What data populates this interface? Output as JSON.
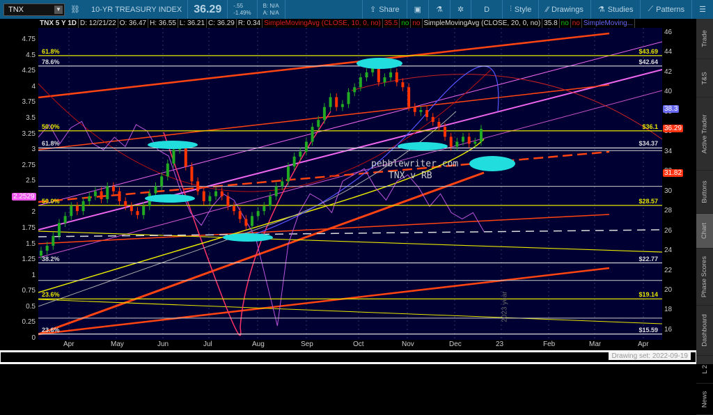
{
  "toolbar": {
    "symbol": "TNX",
    "description": "10-YR TREASURY INDEX",
    "last": "36.29",
    "change": "-.55",
    "change_pct": "-1.49%",
    "bid": "B: N/A",
    "ask": "A: N/A",
    "share": "Share",
    "period": "D",
    "style": "Style",
    "drawings": "Drawings",
    "studies": "Studies",
    "patterns": "Patterns"
  },
  "info": {
    "title": "TNX 5 Y 1D",
    "date": "D: 12/21/22",
    "open": "O: 36.47",
    "high": "H: 36.55",
    "low": "L: 36.21",
    "close": "C: 36.29",
    "range": "R: 0.34",
    "sma1": "SimpleMovingAvg (CLOSE, 10, 0, no)",
    "sma1_val": "35.5",
    "no": "no",
    "sma2": "SimpleMovingAvg (CLOSE, 20, 0, no)",
    "sma2_val": "35.8",
    "sma3": "SimpleMoving..."
  },
  "chart_data": {
    "type": "candlestick",
    "right_axis": {
      "ticks": [
        "46",
        "44",
        "42",
        "40",
        "38",
        "36",
        "34",
        "32",
        "30",
        "28",
        "26",
        "24",
        "22",
        "20",
        "18",
        "16"
      ],
      "range": [
        15,
        46.5
      ]
    },
    "left_axis": {
      "ticks": [
        "4.75",
        "4.5",
        "4.25",
        "4",
        "3.75",
        "3.5",
        "3.25",
        "3",
        "2.75",
        "2.5",
        "2",
        "1.75",
        "1.5",
        "1.25",
        "1",
        "0.75",
        "0.5",
        "0.25",
        "0"
      ],
      "range": [
        0,
        4.95
      ]
    },
    "x_ticks": [
      "Apr",
      "May",
      "Jun",
      "Jul",
      "Aug",
      "Sep",
      "Oct",
      "Nov",
      "Dec",
      "23",
      "Feb",
      "Mar",
      "Apr"
    ],
    "year_marker": "2023 year",
    "closes": [
      24,
      24.5,
      25.5,
      26.8,
      27.5,
      28.5,
      28,
      29,
      29.5,
      30,
      29.2,
      30.5,
      30,
      29,
      28.5,
      28,
      27.6,
      28.5,
      29.8,
      30.5,
      31.5,
      32.8,
      34.2,
      34.5,
      32.5,
      31,
      30,
      29,
      29.5,
      30,
      29.5,
      28.5,
      28,
      27.2,
      26.5,
      27.5,
      28,
      28.5,
      29.5,
      30.5,
      31,
      32.5,
      33.5,
      34,
      35,
      36.5,
      37.2,
      38.5,
      39.5,
      38.5,
      38.8,
      40,
      40.5,
      41.5,
      42,
      42.5,
      41,
      41.5,
      42,
      41,
      40.5,
      38.5,
      38,
      38.2,
      37.5,
      37,
      36.5,
      35.5,
      34.5,
      35,
      35.5,
      34.8,
      35,
      36.29
    ],
    "price_levels": [
      {
        "v": 43.69,
        "label": "$43.69",
        "fib": "61.8%",
        "c": "#e8e800"
      },
      {
        "v": 42.64,
        "label": "$42.64",
        "fib": "78.6%",
        "c": "#ddd"
      },
      {
        "v": 36.1,
        "label": "$36.1",
        "fib": "50.0%",
        "c": "#e8e800"
      },
      {
        "v": 34.37,
        "label": "$34.37",
        "fib": "61.8%",
        "c": "#ddd"
      },
      {
        "v": 28.57,
        "label": "$28.57",
        "fib": "50.0%",
        "c": "#e8e800"
      },
      {
        "v": 22.77,
        "label": "$22.77",
        "fib": "38.2%",
        "c": "#ddd"
      },
      {
        "v": 19.14,
        "label": "$19.14",
        "fib": "23.6%",
        "c": "#e8e800"
      },
      {
        "v": 15.59,
        "label": "$15.59",
        "fib": "23.6%",
        "c": "#ddd"
      }
    ],
    "badges": {
      "sma_blue": "38.3",
      "last": "36.29",
      "trend": "31.82",
      "left_overlay": "2.2529"
    },
    "watermark": [
      "pebblewriter.com",
      "TNX v RB"
    ]
  },
  "colors": {
    "chart_bg": "#000033",
    "up": "#22aa22",
    "down": "#ff3300",
    "accent": "#0f5b85"
  },
  "sidebar": {
    "tabs": [
      "Trade",
      "T&S",
      "Active Trader",
      "Buttons",
      "Chart",
      "Phase Scores",
      "Dashboard",
      "L 2",
      "News"
    ],
    "selected": "Chart"
  },
  "bottom": {
    "drawing_set": "Drawing set: 2022-09-19"
  }
}
